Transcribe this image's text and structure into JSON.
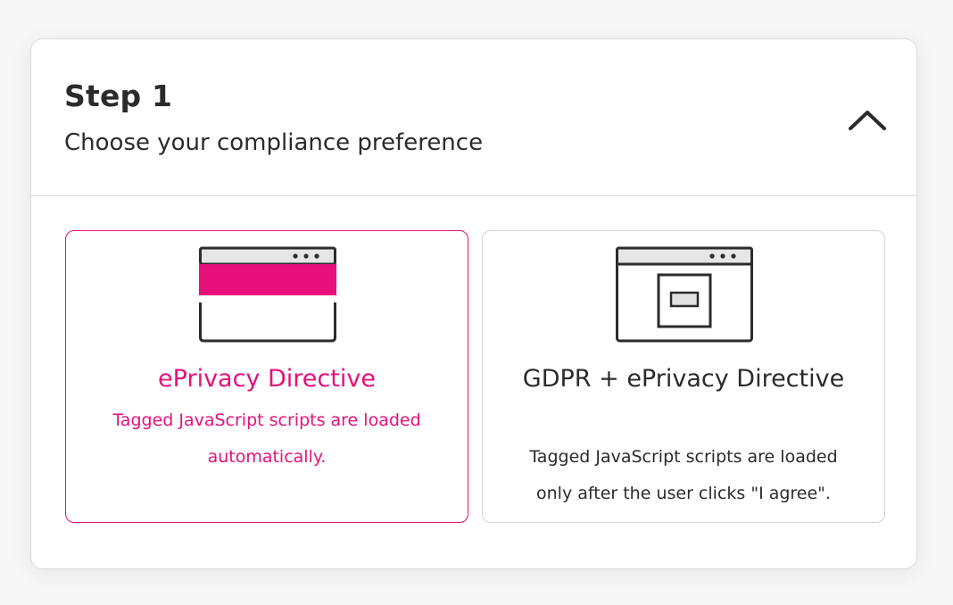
{
  "step": {
    "title": "Step 1",
    "subtitle": "Choose your compliance preference",
    "toggle_icon": "chevron-up-icon"
  },
  "options": [
    {
      "title": "ePrivacy Directive",
      "description": "Tagged JavaScript scripts are loaded automatically.",
      "selected": true,
      "icon": "browser-banner-icon"
    },
    {
      "title": "GDPR + ePrivacy Directive",
      "description": "Tagged JavaScript scripts are loaded only after the user clicks \"I agree\".",
      "selected": false,
      "icon": "browser-modal-icon"
    }
  ],
  "colors": {
    "accent": "#e8107a",
    "text": "#2b2b2b",
    "border": "#d4d4d4"
  }
}
